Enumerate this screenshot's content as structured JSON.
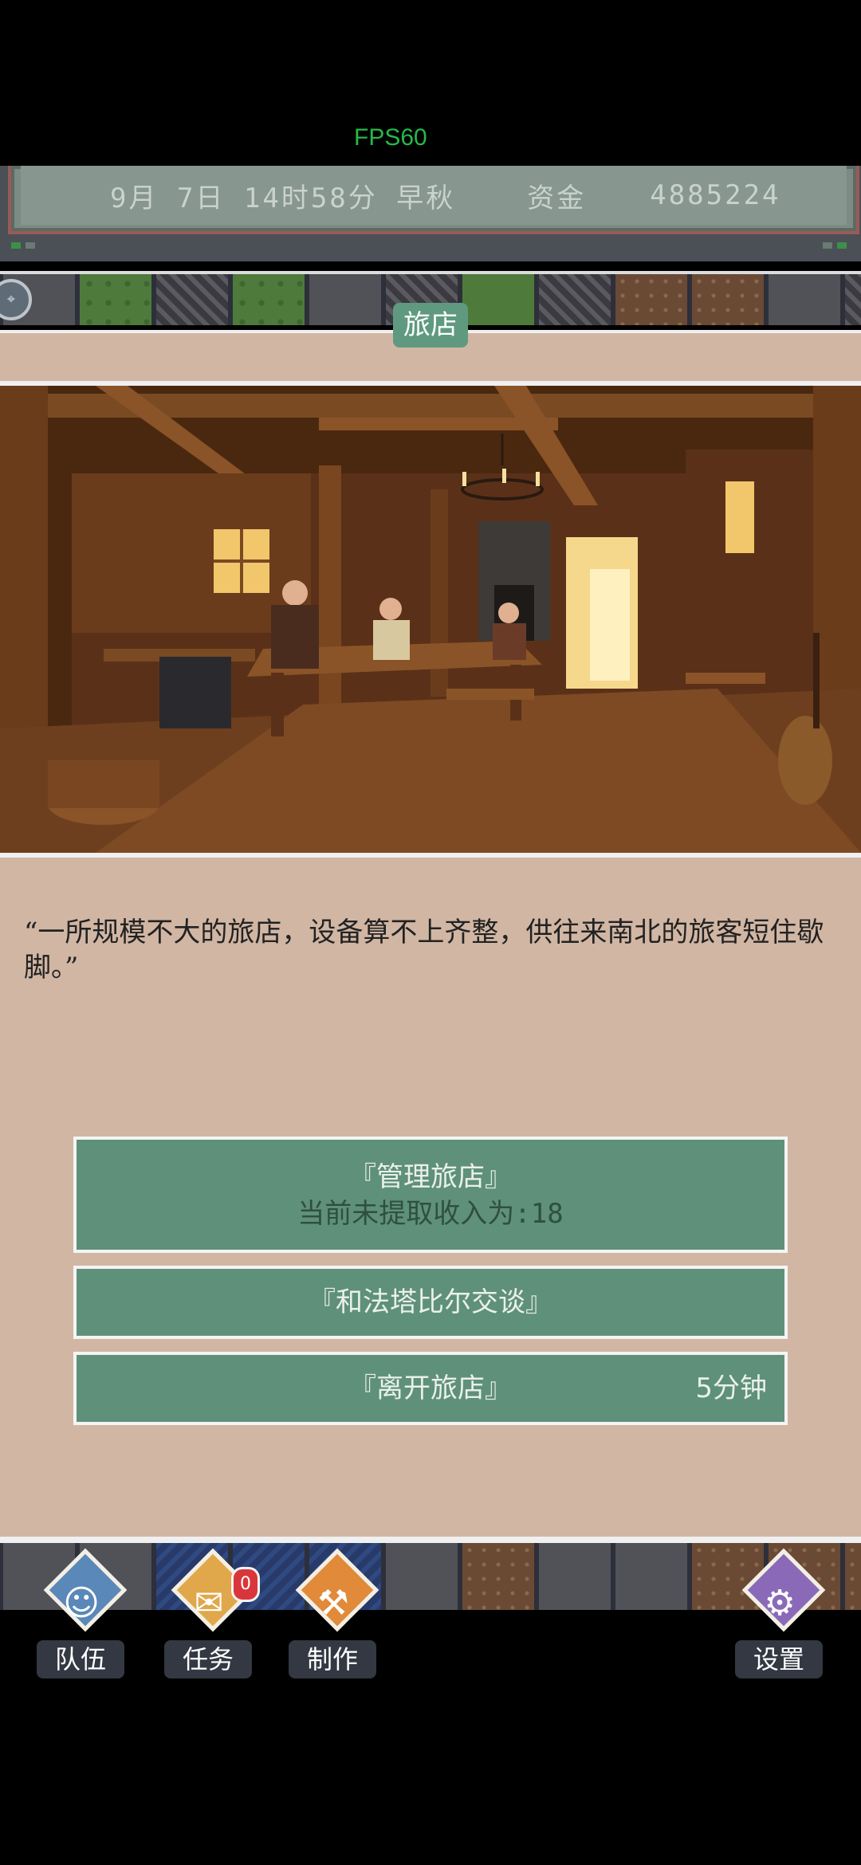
{
  "fps": "FPS60",
  "status": {
    "date_time": "9月 7日 14时58分 早秋",
    "funds_label": "资金",
    "funds_value": "4885224"
  },
  "location": {
    "title": "旅店"
  },
  "scene": {
    "image": "tavern-interior-illustration"
  },
  "description": "“一所规模不大的旅店，设备算不上齐整，供往来南北的旅客短住歇脚。”",
  "options": {
    "manage": {
      "label": "『管理旅店』",
      "income_text": "当前未提取收入为:18"
    },
    "talk": {
      "label": "『和法塔比尔交谈』"
    },
    "leave": {
      "label": "『离开旅店』",
      "duration": "5分钟"
    }
  },
  "nav": {
    "team": {
      "label": "队伍",
      "icon": "team-icon"
    },
    "quests": {
      "label": "任务",
      "icon": "quest-icon",
      "badge": "0"
    },
    "craft": {
      "label": "制作",
      "icon": "craft-icon"
    },
    "settings": {
      "label": "设置",
      "icon": "gear-icon"
    }
  },
  "colors": {
    "fps": "#27b84a",
    "option_bg": "#5f907a",
    "parchment": "#d1b6a4",
    "location_tag": "#5f9a80",
    "badge_red": "#d9363b"
  }
}
